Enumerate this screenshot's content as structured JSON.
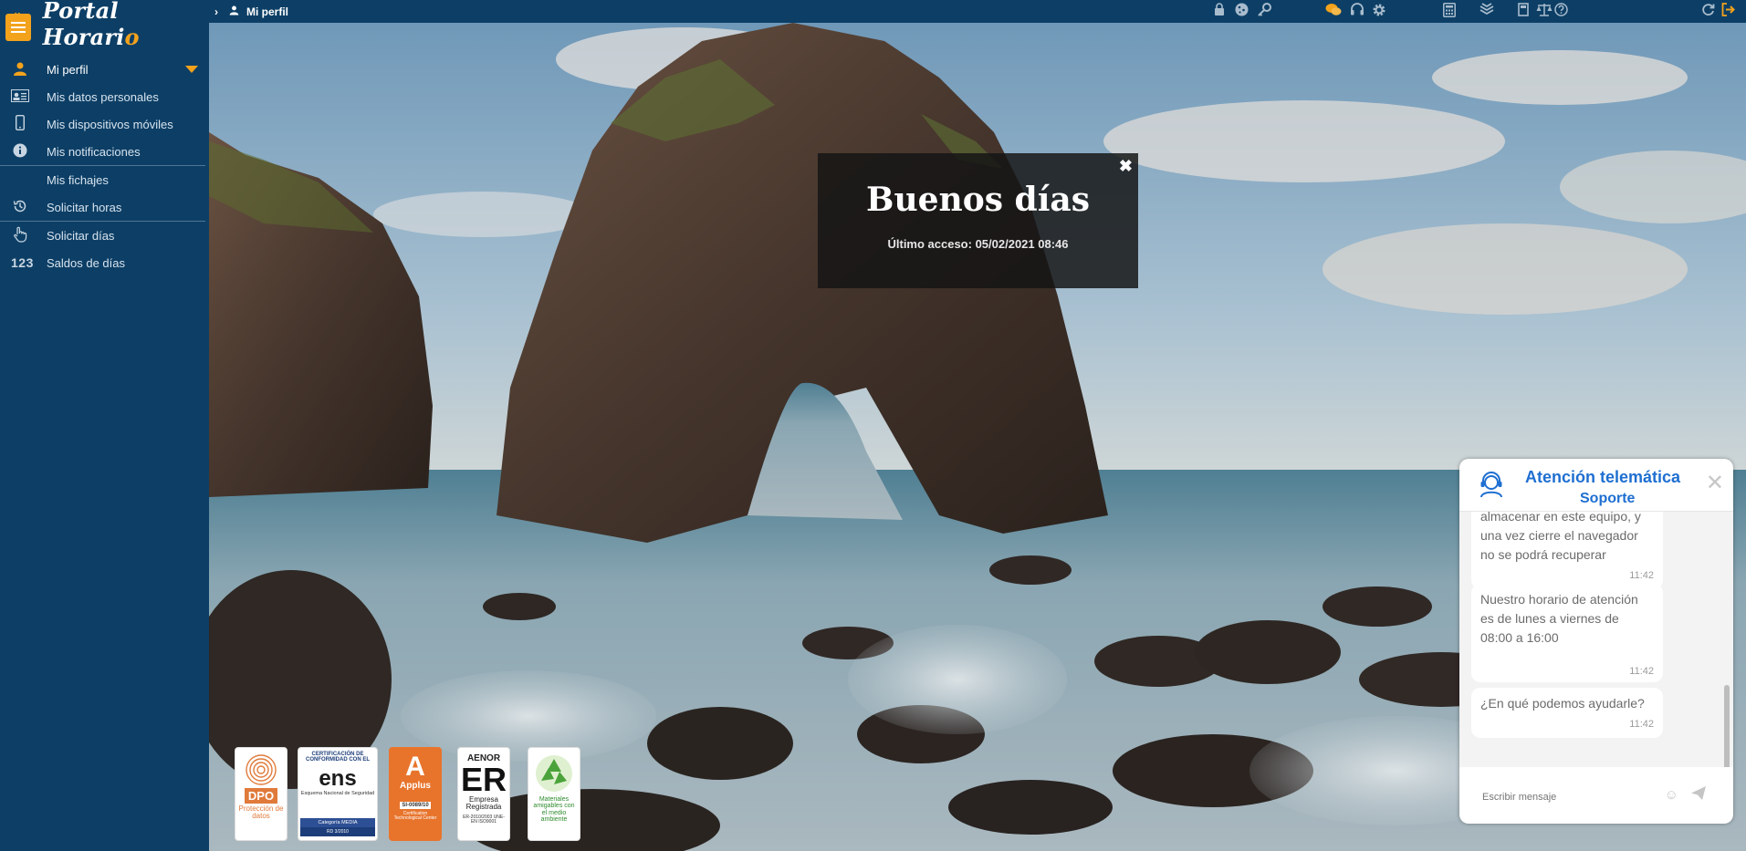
{
  "app": {
    "brand_left": "Portal Horari",
    "brand_o": "o"
  },
  "breadcrumb": {
    "current": "Mi perfil"
  },
  "sidebar": {
    "items": [
      {
        "label": "Mi perfil",
        "icon": "user-icon"
      },
      {
        "label": "Mis datos personales",
        "icon": "id-card-icon"
      },
      {
        "label": "Mis dispositivos móviles",
        "icon": "mobile-icon"
      },
      {
        "label": "Mis notificaciones",
        "icon": "info-icon"
      },
      {
        "label": "Mis fichajes",
        "icon": ""
      },
      {
        "label": "Solicitar horas",
        "icon": "history-icon"
      },
      {
        "label": "Solicitar días",
        "icon": "hand-pointer-icon"
      },
      {
        "label": "Saldos de días",
        "icon": "numbers-icon"
      }
    ],
    "numbers_glyph": "123"
  },
  "greeting": {
    "title": "Buenos días",
    "subtitle": "Último acceso: 05/02/2021 08:46",
    "close": "✖"
  },
  "badges": {
    "dpo_title": "DPO",
    "dpo_sub": "Protección de datos",
    "ens_top": "CERTIFICACIÓN DE CONFORMIDAD CON EL",
    "ens_logo": "ens",
    "ens_mid": "Esquema Nacional de Seguridad",
    "ens_level": "Categoría MEDIA",
    "ens_code": "RD 3/2010",
    "applus_logo": "A",
    "applus_name": "Applus",
    "applus_code": "SI-0089/10",
    "applus_foot": "Certification Technological Center",
    "aenor_top": "AENOR",
    "aenor_logo": "ER",
    "aenor_name": "Empresa Registrada",
    "aenor_code": "ER-2010/2003 UNE-EN ISO9001",
    "eco_text": "Materiales amigables con el medio ambiente"
  },
  "chat": {
    "title": "Atención telemática",
    "subtitle": "Soporte",
    "close": "✕",
    "messages": [
      {
        "text": "almacenar en este equipo, y una vez cierre el navegador no se podrá recuperar",
        "time": "11:42"
      },
      {
        "text": "Nuestro horario de atención es de lunes a viernes de 08:00 a 16:00",
        "time": "11:42"
      },
      {
        "text": "¿En qué podemos ayudarle?",
        "time": "11:42"
      }
    ],
    "placeholder": "Escribir mensaje"
  },
  "colors": {
    "sidebar_bg": "#0d3f66",
    "accent": "#f3a21c",
    "chat_accent": "#1f6fd1"
  }
}
